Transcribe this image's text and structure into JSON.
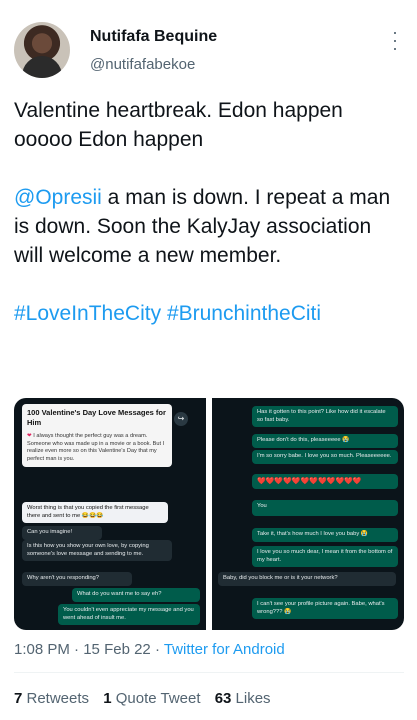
{
  "author": {
    "name": "Nutifafa Bequine",
    "handle": "@nutifafabekoe"
  },
  "tweet": {
    "line1": "Valentine heartbreak.  Edon happen ooooo Edon happen",
    "mention": "@Opresii",
    "line2_rest": " a man is down. I repeat a man is down. Soon the KalyJay association will welcome a new member.",
    "hashtag1": "#LoveInTheCity",
    "hashtag2": "#BrunchintheCiti"
  },
  "media": {
    "left": {
      "card_title": "100 Valentine's Day Love Messages for Him",
      "card_body": "I always thought the perfect guy was a dream. Someone who was made up in a movie or a book. But I realize even more so on this Valentine's Day that my perfect man is you.",
      "messages": [
        "Worst thing is that you copied the first message there and sent to me 😂😂😂",
        "Can you imagine!",
        "Is this how you show your own love, by copying someone's love message and sending to me.",
        "Why aren't you responding?",
        "What do you want me to say eh?",
        "You couldn't even appreciate my message and you went ahead of insult me."
      ]
    },
    "right": {
      "messages": [
        "Has it gotten to this point? Like how did it escalate so fast baby.",
        "Please don't do this, pleaseeeee 😭",
        "I'm so sorry babe. I love you so much. Pleaseeeeee.",
        "❤️❤️❤️❤️❤️❤️❤️❤️❤️❤️❤️❤️",
        "You",
        "Take it, that's how much I love you baby 😭",
        "I love you so much dear, I mean it from the bottom of my heart.",
        "Baby, did you block me or is it your network?",
        "I can't see your profile picture again. Babe, what's wrong??? 😭"
      ]
    }
  },
  "meta": {
    "time": "1:08 PM",
    "sep1": " · ",
    "date": "15 Feb 22",
    "sep2": " · ",
    "source": "Twitter for Android"
  },
  "stats": {
    "retweets_count": "7",
    "retweets_label": " Retweets",
    "quotes_count": "1",
    "quotes_label": " Quote Tweet",
    "likes_count": "63",
    "likes_label": " Likes"
  }
}
